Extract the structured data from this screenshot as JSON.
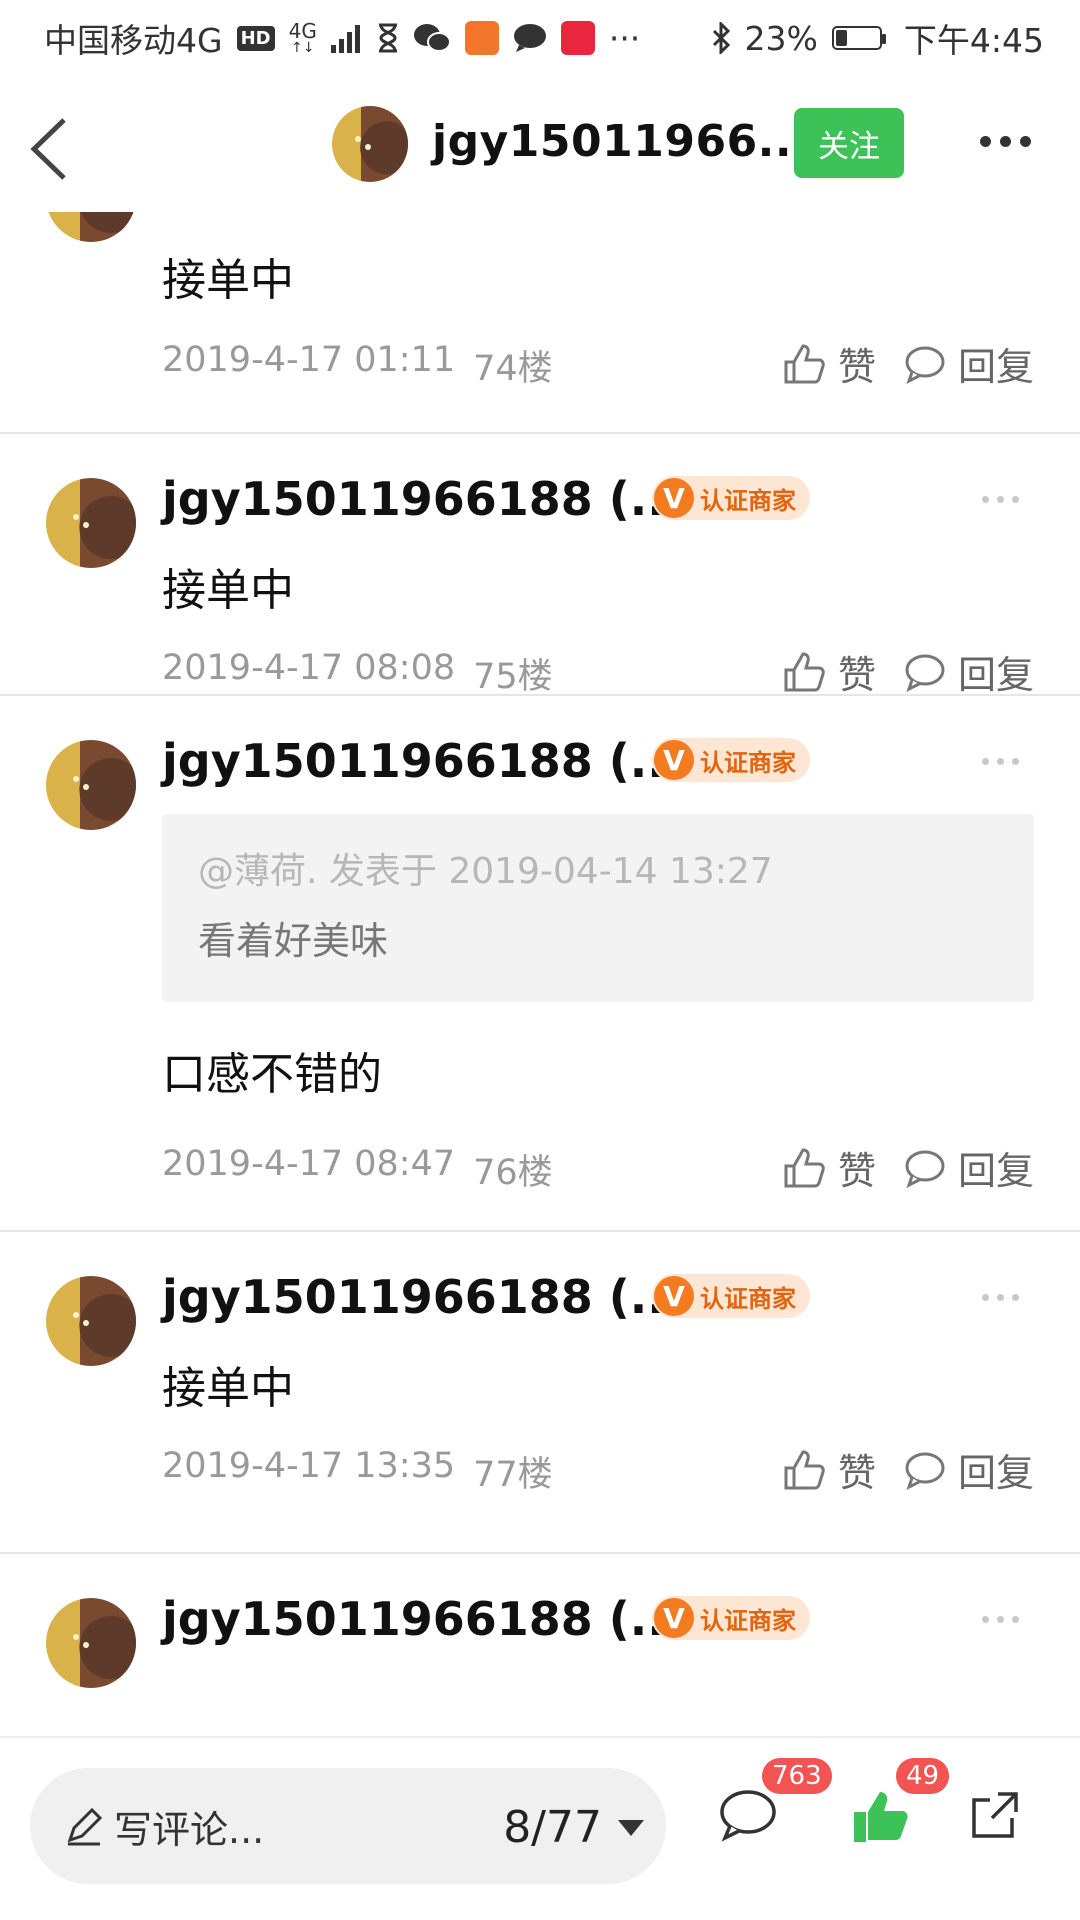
{
  "status_bar": {
    "carrier": "中国移动4G",
    "hd": "HD",
    "net_top": "4G",
    "net_bottom": "↑↓",
    "more": "···",
    "battery_percent": "23%",
    "time": "下午4:45"
  },
  "header": {
    "title": "jgy15011966...",
    "follow_label": "关注"
  },
  "top_partial": {
    "content": "接单中",
    "time": "2019-4-17 01:11",
    "floor": "74楼"
  },
  "posts": [
    {
      "name": "jgy15011966188 (...",
      "cert": "认证商家",
      "cert_v": "V",
      "content": "接单中",
      "time": "2019-4-17 08:08",
      "floor": "75楼"
    },
    {
      "name": "jgy15011966188 (...",
      "cert": "认证商家",
      "cert_v": "V",
      "quote_header": "@薄荷. 发表于 2019-04-14 13:27",
      "quote_text": "看着好美味",
      "content": "口感不错的",
      "time": "2019-4-17 08:47",
      "floor": "76楼"
    },
    {
      "name": "jgy15011966188 (...",
      "cert": "认证商家",
      "cert_v": "V",
      "content": "接单中",
      "time": "2019-4-17 13:35",
      "floor": "77楼"
    },
    {
      "name": "jgy15011966188 (...",
      "cert": "认证商家",
      "cert_v": "V"
    }
  ],
  "actions": {
    "like_label": "赞",
    "reply_label": "回复"
  },
  "bottom_bar": {
    "comment_placeholder": "写评论...",
    "page": "8/77",
    "comment_count": "763",
    "like_count": "49"
  },
  "colors": {
    "accent_green": "#3cc256",
    "cert_orange": "#f47b20",
    "badge_red": "#f25454"
  }
}
